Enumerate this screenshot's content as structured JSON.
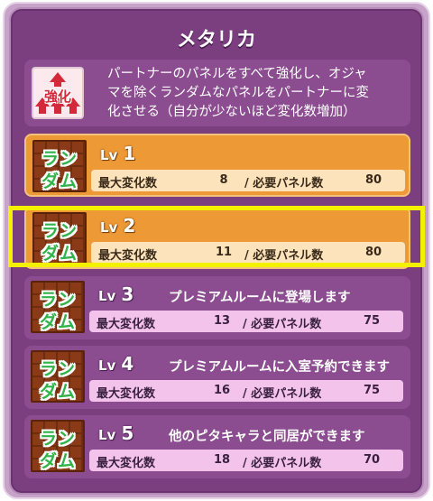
{
  "title": "メタリカ",
  "skill": {
    "icon_text": "強化",
    "icon_name": "power-up-icon",
    "description_lines": [
      "パートナーのパネルをすべて強化し、オジャ",
      "マを除くランダムなパネルをパートナーに変",
      "化させる（自分が少ないほど変化数増加）"
    ]
  },
  "panel_type": {
    "line1": "ラン",
    "line2": "ダム"
  },
  "labels": {
    "lv": "Lv",
    "max_change": "最大変化数",
    "required_panels": "/ 必要パネル数"
  },
  "levels": [
    {
      "lv": "1",
      "desc": "",
      "max_change": "8",
      "required": "80",
      "state": "unlocked"
    },
    {
      "lv": "2",
      "desc": "",
      "max_change": "11",
      "required": "80",
      "state": "current"
    },
    {
      "lv": "3",
      "desc": "プレミアムルームに登場します",
      "max_change": "13",
      "required": "75",
      "state": "locked"
    },
    {
      "lv": "4",
      "desc": "プレミアムルームに入室予約できます",
      "max_change": "16",
      "required": "75",
      "state": "locked"
    },
    {
      "lv": "5",
      "desc": "他のピタキャラと同居ができます",
      "max_change": "18",
      "required": "70",
      "state": "locked"
    }
  ],
  "colors": {
    "panel_bg": "#7b3f80",
    "active_row": "#ec9936",
    "inactive_row": "#8b4d90",
    "highlight": "#f3f000",
    "random_text": "#32b34a"
  }
}
